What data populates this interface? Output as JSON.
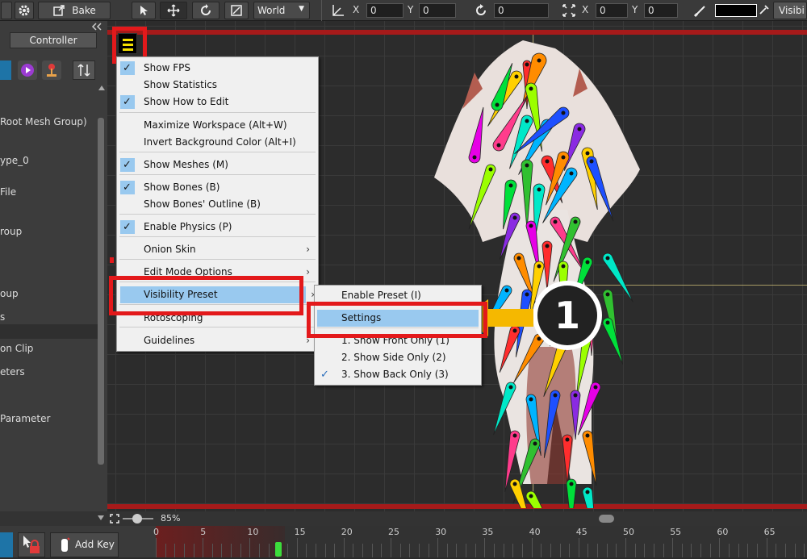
{
  "toolbar": {
    "bake_label": "Bake",
    "space_select": "World",
    "pos_x_label": "X",
    "pos_x_value": "0",
    "pos_y_label": "Y",
    "pos_y_value": "0",
    "rotation_value": "0",
    "scale_x_label": "X",
    "scale_x_value": "0",
    "scale_y_label": "Y",
    "scale_y_value": "0",
    "visibility_label": "Visibi"
  },
  "left_panel": {
    "controller_tab": "Controller",
    "items": [
      "Root Mesh Group)",
      "ype_0",
      "File",
      "roup",
      "oup",
      "s",
      "on Clip",
      "eters",
      "Parameter"
    ]
  },
  "view_menu": {
    "items": [
      {
        "label": "Show FPS",
        "checked": true
      },
      {
        "label": "Show Statistics",
        "checked": false
      },
      {
        "label": "Show How to Edit",
        "checked": true
      },
      {
        "label": "Maximize Workspace (Alt+W)",
        "checked": false
      },
      {
        "label": "Invert Background Color (Alt+I)",
        "checked": false
      },
      {
        "label": "Show Meshes (M)",
        "checked": true
      },
      {
        "label": "Show Bones (B)",
        "checked": true
      },
      {
        "label": "Show Bones' Outline (B)",
        "checked": false
      },
      {
        "label": "Enable Physics (P)",
        "checked": true
      },
      {
        "label": "Onion Skin",
        "checked": false
      },
      {
        "label": "Edit Mode Options",
        "checked": false
      },
      {
        "label": "Visibility Preset",
        "checked": false
      },
      {
        "label": "Rotoscoping",
        "checked": false
      },
      {
        "label": "Guidelines",
        "checked": false
      }
    ]
  },
  "preset_submenu": {
    "items": [
      {
        "label": "Enable Preset (I)",
        "checked": false
      },
      {
        "label": "Settings",
        "checked": false
      },
      {
        "label": "1. Show Front Only (1)",
        "checked": false
      },
      {
        "label": "2. Show Side Only (2)",
        "checked": false
      },
      {
        "label": "3. Show Back Only (3)",
        "checked": true
      }
    ]
  },
  "annotation": {
    "step_number": "1"
  },
  "status": {
    "zoom": "85%"
  },
  "timeline": {
    "add_key_label": "Add Key",
    "ticks": [
      "0",
      "5",
      "10",
      "15",
      "20",
      "25",
      "30",
      "35",
      "40",
      "45",
      "50",
      "55",
      "60",
      "65"
    ]
  },
  "colors": {
    "menu_highlight": "#99c9ef",
    "callout_red": "#e3191b",
    "arrow_orange": "#f5b800",
    "timeline_bar": "#a61a1a"
  }
}
